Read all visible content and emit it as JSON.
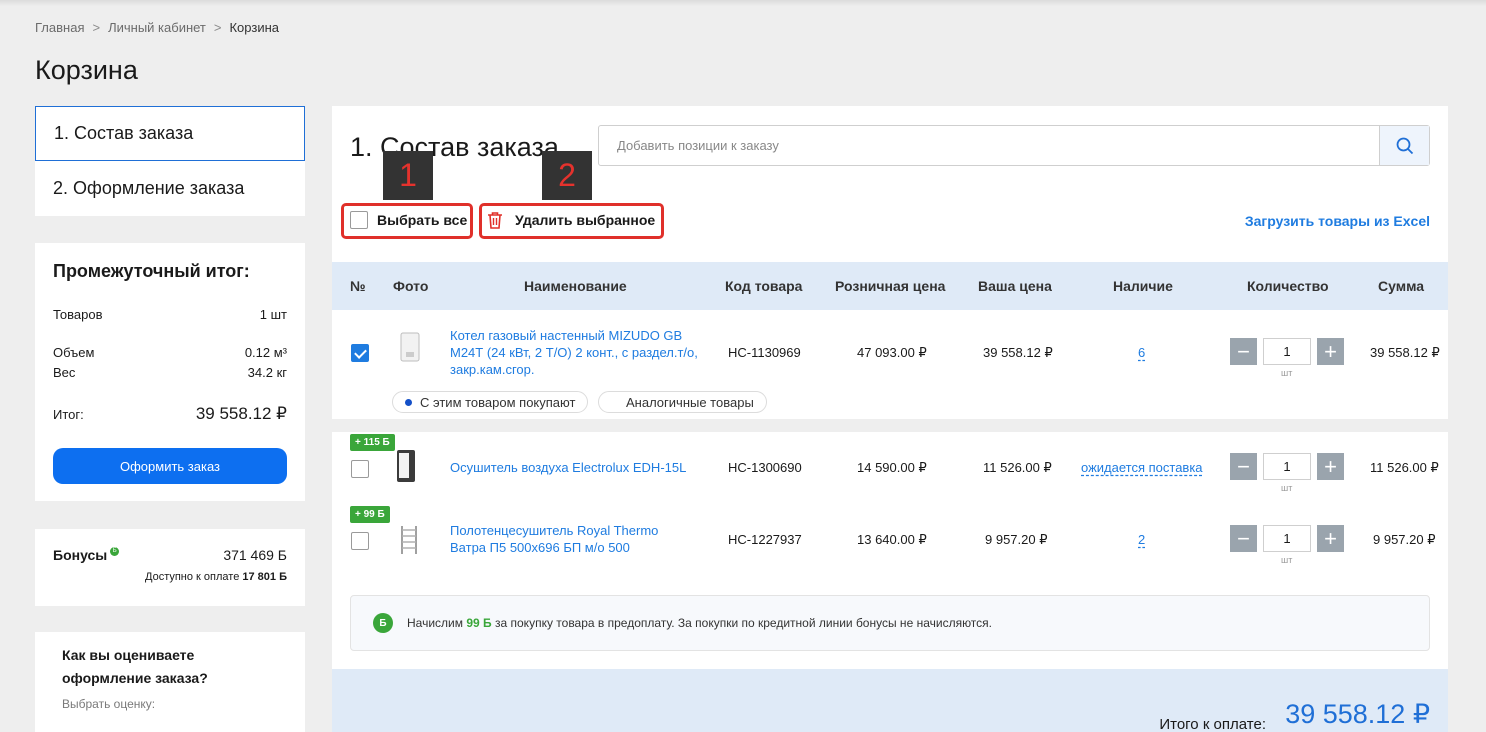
{
  "breadcrumb": {
    "home": "Главная",
    "cabinet": "Личный кабинет",
    "current": "Корзина",
    "sep": ">"
  },
  "page_title": "Корзина",
  "steps": [
    {
      "label": "1. Состав заказа",
      "active": true
    },
    {
      "label": "2. Оформление заказа",
      "active": false
    }
  ],
  "summary": {
    "title": "Промежуточный итог:",
    "items_label": "Товаров",
    "items_value": "1 шт",
    "volume_label": "Объем",
    "volume_value": "0.12 м³",
    "weight_label": "Вес",
    "weight_value": "34.2 кг",
    "total_label": "Итог:",
    "total_value": "39 558.12 ₽",
    "order_button": "Оформить заказ"
  },
  "bonus": {
    "label": "Бонусы",
    "icon_letter": "Б",
    "value": "371 469 Б",
    "available_label": "Доступно к оплате",
    "available_value": "17 801 Б"
  },
  "rating": {
    "question": "Как вы оцениваете оформление заказа?",
    "hint": "Выбрать оценку:"
  },
  "main": {
    "title": "1. Состав заказа",
    "search_placeholder": "Добавить позиции к заказу",
    "select_all": "Выбрать все",
    "delete_selected": "Удалить выбранное",
    "upload_excel": "Загрузить товары из Excel",
    "annotations": [
      "1",
      "2"
    ]
  },
  "table": {
    "headers": [
      "№",
      "Фото",
      "Наименование",
      "Код товара",
      "Розничная цена",
      "Ваша цена",
      "Наличие",
      "Количество",
      "Сумма"
    ],
    "unit": "шт",
    "rows": [
      {
        "checked": true,
        "badge": "",
        "name": "Котел газовый настенный MIZUDO GB М24Т (24 кВт, 2 Т/О) 2 конт., с раздел.т/о, закр.кам.сгор.",
        "code": "НС-1130969",
        "retail": "47 093.00 ₽",
        "price": "39 558.12 ₽",
        "availability": "6",
        "qty": "1",
        "sum": "39 558.12 ₽",
        "tags": [
          "С этим товаром покупают",
          "Аналогичные товары"
        ]
      },
      {
        "checked": false,
        "badge": "+ 115 Б",
        "name": "Осушитель воздуха Electrolux EDH-15L",
        "code": "НС-1300690",
        "retail": "14 590.00 ₽",
        "price": "11 526.00 ₽",
        "availability": "ожидается поставка",
        "qty": "1",
        "sum": "11 526.00 ₽"
      },
      {
        "checked": false,
        "badge": "+ 99 Б",
        "name": "Полотенцесушитель Royal Thermo Ватра П5 500х696 БП м/о 500",
        "code": "НС-1227937",
        "retail": "13 640.00 ₽",
        "price": "9 957.20 ₽",
        "availability": "2",
        "qty": "1",
        "sum": "9 957.20 ₽"
      }
    ]
  },
  "notice": {
    "icon_letter": "Б",
    "text_before": "Начислим",
    "points": "99 Б",
    "text_after": "за покупку товара в предоплату. За покупки по кредитной линии бонусы не начисляются."
  },
  "total": {
    "label": "Итого к оплате:",
    "value": "39 558.12 ₽"
  },
  "colors": {
    "accent": "#1f7ce0",
    "button": "#0d6ff0",
    "bonus_green": "#3aa63a",
    "annotation_red": "#e0302a",
    "header_bg": "#dfeaf7"
  },
  "icons": {
    "search": "search-icon",
    "trash": "trash-icon",
    "minus": "minus-icon",
    "plus": "plus-icon"
  }
}
